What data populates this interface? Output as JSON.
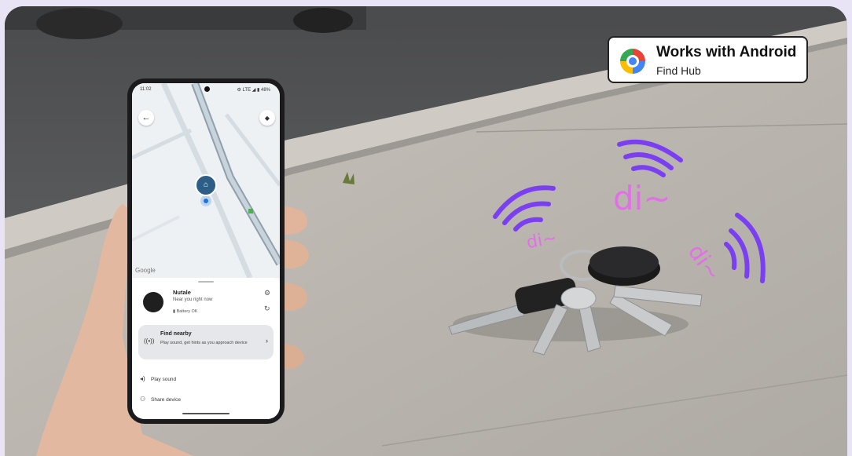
{
  "badge": {
    "line1": "Works with Android",
    "line2": "Find Hub",
    "icon": "find-hub-logo"
  },
  "phone": {
    "status": {
      "time": "11:02",
      "right": "⚙ LTE ◢ ▮ 48%"
    },
    "map": {
      "back_icon": "arrow-back-icon",
      "layers_icon": "layers-icon",
      "attribution": "Google"
    },
    "device": {
      "name": "Nutale",
      "status": "Near you right now",
      "battery": "Battery OK"
    },
    "find_nearby": {
      "title": "Find nearby",
      "description": "Play sound, get hints as you approach device"
    },
    "actions": [
      {
        "label": "Play sound",
        "icon": "speaker-icon"
      },
      {
        "label": "Share device",
        "icon": "share-person-icon"
      }
    ]
  },
  "sound_labels": [
    "di~",
    "di~",
    "di~"
  ],
  "colors": {
    "wave": "#7b3ff2",
    "di_text": "#e36fe8",
    "map_pin": "#2d5f86"
  }
}
